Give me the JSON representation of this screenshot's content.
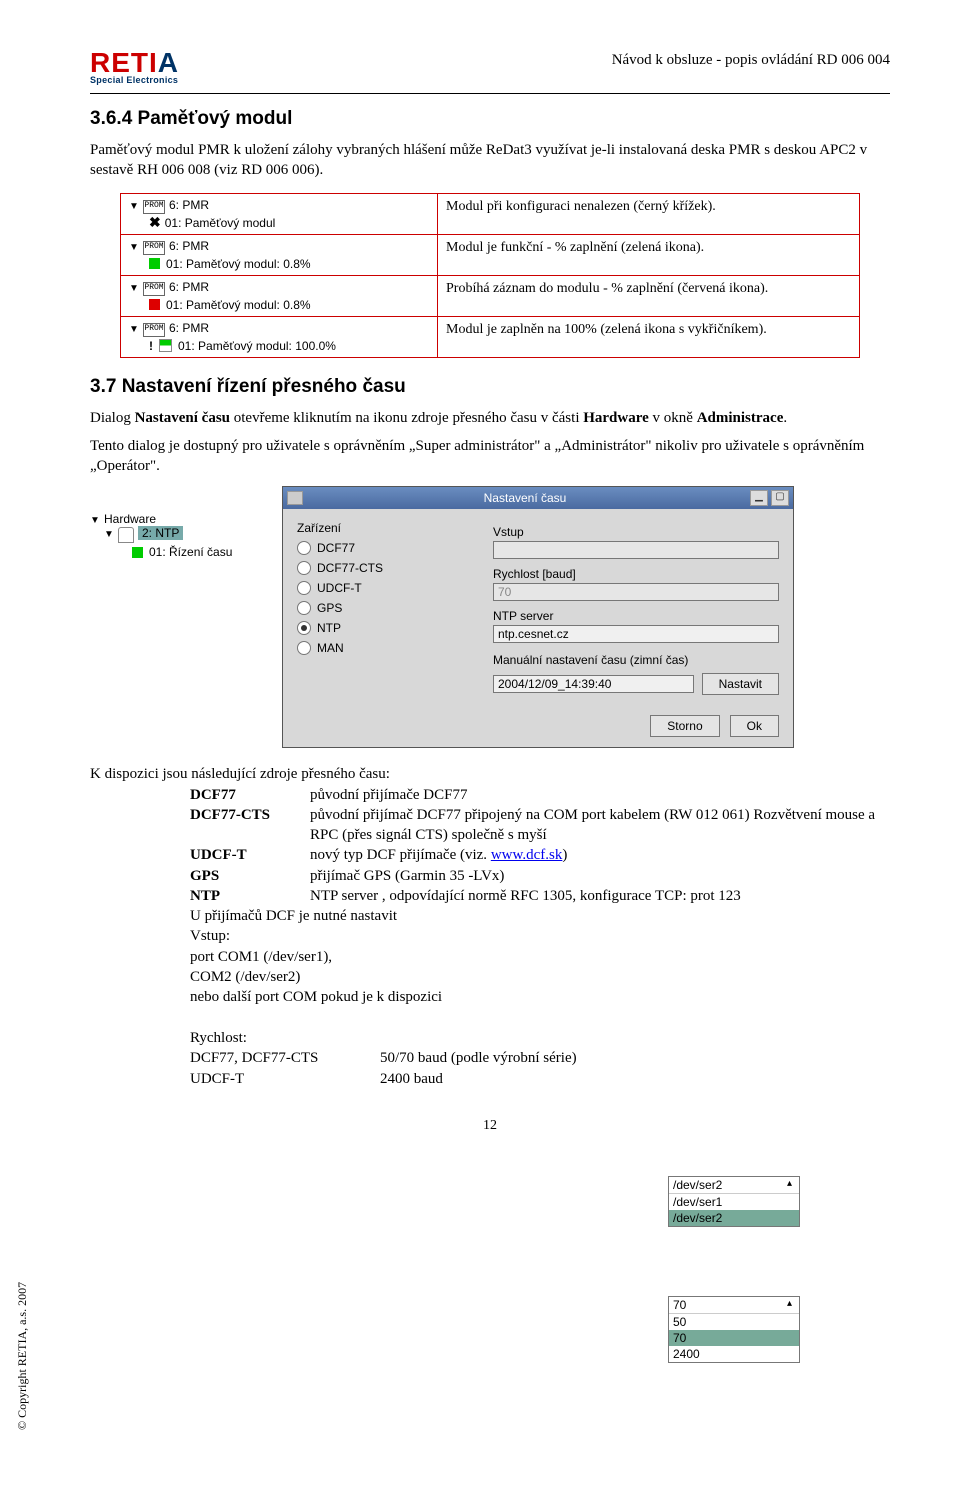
{
  "header": {
    "logo_text": "RETI",
    "logo_a": "A",
    "logo_sub": "Special Electronics",
    "doc_title": "Návod k obsluze - popis ovládání RD 006 004"
  },
  "sec1": {
    "heading": "3.6.4  Paměťový modul",
    "intro": "Paměťový modul PMR k uložení  zálohy vybraných hlášení může ReDat3 využívat je-li instalovaná deska PMR s deskou APC2 v sestavě RH 006 008 (viz RD 006 006)."
  },
  "mod_rows": [
    {
      "title": "6: PMR",
      "sub": "01: Paměťový modul",
      "ind": "x",
      "right": "Modul při konfiguraci nenalezen (černý křížek)."
    },
    {
      "title": "6: PMR",
      "sub": "01: Paměťový modul: 0.8%",
      "ind": "g",
      "right": "Modul je funkční - % zaplnění (zelená ikona)."
    },
    {
      "title": "6: PMR",
      "sub": "01: Paměťový modul: 0.8%",
      "ind": "r",
      "right": "Probíhá záznam do modulu - % zaplnění (červená ikona)."
    },
    {
      "title": "6: PMR",
      "sub": "01: Paměťový modul: 100.0%",
      "ind": "gb",
      "right": "Modul je zaplněn na 100% (zelená ikona s vykřičníkem)."
    }
  ],
  "sec2": {
    "heading": "3.7   Nastavení řízení přesného času",
    "p1_a": "Dialog ",
    "p1_b": "Nastavení času",
    "p1_c": " otevřeme kliknutím na ikonu zdroje přesného času v části ",
    "p1_d": "Hardware",
    "p1_e": " v okně ",
    "p1_f": "Administrace",
    "p1_g": ".",
    "p2": "Tento dialog je dostupný pro uživatele s oprávněním „Super administrátor\" a „Administrátor\" nikoliv pro uživatele s oprávněním „Operátor\"."
  },
  "hwtree": {
    "root": "Hardware",
    "sel": "2: NTP",
    "sub": "01: Řízení času"
  },
  "dialog": {
    "title": "Nastavení času",
    "dev_label": "Zařízení",
    "radios": [
      "DCF77",
      "DCF77-CTS",
      "UDCF-T",
      "GPS",
      "NTP",
      "MAN"
    ],
    "sel_radio": 4,
    "vstup_label": "Vstup",
    "rychlost_label": "Rychlost [baud]",
    "rychlost_val": "70",
    "ntp_label": "NTP server",
    "ntp_val": "ntp.cesnet.cz",
    "man_label": "Manuální nastavení času (zimní čas)",
    "man_val": "2004/12/09_14:39:40",
    "nastavit": "Nastavit",
    "storno": "Storno",
    "ok": "Ok"
  },
  "txt3": {
    "intro": "K dispozici jsou následující zdroje přesného času:",
    "defs": [
      {
        "t": "DCF77",
        "d": "původní přijímače DCF77"
      },
      {
        "t": "DCF77-CTS",
        "d": "původní přijímač DCF77 připojený na COM port kabelem (RW 012 061) Rozvětvení mouse a RPC (přes signál CTS) společně s myší"
      },
      {
        "t": "UDCF-T",
        "d_pre": "nový typ DCF přijímače (viz. ",
        "link": "www.dcf.sk",
        "d_post": ")"
      },
      {
        "t": "GPS",
        "d": "přijímač GPS (Garmin 35 -LVx)"
      },
      {
        "t": "NTP",
        "d": "NTP server , odpovídající normě RFC 1305, konfigurace TCP: prot 123"
      }
    ],
    "tail": [
      "U přijímačů DCF je nutné nastavit",
      "Vstup:",
      "port COM1 (/dev/ser1),",
      "COM2 (/dev/ser2)",
      "nebo další port COM pokud je k dispozici"
    ],
    "tail2_label": "Rychlost:",
    "tail2_rows": [
      {
        "a": "DCF77, DCF77-CTS",
        "b": "50/70 baud (podle výrobní série)"
      },
      {
        "a": "UDCF-T",
        "b": "2400 baud"
      }
    ]
  },
  "combo1": {
    "top": "/dev/ser2",
    "opts": [
      "/dev/ser1",
      "/dev/ser2"
    ],
    "sel": 1
  },
  "combo2": {
    "top": "70",
    "opts": [
      "50",
      "70",
      "2400"
    ],
    "sel": 1
  },
  "footer": {
    "page": "12",
    "copyright": "© Copyright RETIA, a.s. 2007"
  }
}
